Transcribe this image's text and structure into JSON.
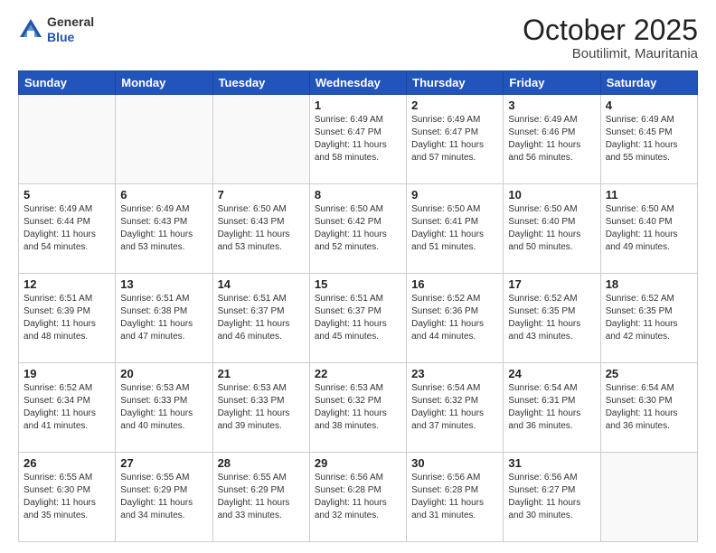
{
  "header": {
    "logo_general": "General",
    "logo_blue": "Blue",
    "month_title": "October 2025",
    "location": "Boutilimit, Mauritania"
  },
  "weekdays": [
    "Sunday",
    "Monday",
    "Tuesday",
    "Wednesday",
    "Thursday",
    "Friday",
    "Saturday"
  ],
  "weeks": [
    [
      {
        "day": "",
        "info": ""
      },
      {
        "day": "",
        "info": ""
      },
      {
        "day": "",
        "info": ""
      },
      {
        "day": "1",
        "info": "Sunrise: 6:49 AM\nSunset: 6:47 PM\nDaylight: 11 hours and 58 minutes."
      },
      {
        "day": "2",
        "info": "Sunrise: 6:49 AM\nSunset: 6:47 PM\nDaylight: 11 hours and 57 minutes."
      },
      {
        "day": "3",
        "info": "Sunrise: 6:49 AM\nSunset: 6:46 PM\nDaylight: 11 hours and 56 minutes."
      },
      {
        "day": "4",
        "info": "Sunrise: 6:49 AM\nSunset: 6:45 PM\nDaylight: 11 hours and 55 minutes."
      }
    ],
    [
      {
        "day": "5",
        "info": "Sunrise: 6:49 AM\nSunset: 6:44 PM\nDaylight: 11 hours and 54 minutes."
      },
      {
        "day": "6",
        "info": "Sunrise: 6:49 AM\nSunset: 6:43 PM\nDaylight: 11 hours and 53 minutes."
      },
      {
        "day": "7",
        "info": "Sunrise: 6:50 AM\nSunset: 6:43 PM\nDaylight: 11 hours and 53 minutes."
      },
      {
        "day": "8",
        "info": "Sunrise: 6:50 AM\nSunset: 6:42 PM\nDaylight: 11 hours and 52 minutes."
      },
      {
        "day": "9",
        "info": "Sunrise: 6:50 AM\nSunset: 6:41 PM\nDaylight: 11 hours and 51 minutes."
      },
      {
        "day": "10",
        "info": "Sunrise: 6:50 AM\nSunset: 6:40 PM\nDaylight: 11 hours and 50 minutes."
      },
      {
        "day": "11",
        "info": "Sunrise: 6:50 AM\nSunset: 6:40 PM\nDaylight: 11 hours and 49 minutes."
      }
    ],
    [
      {
        "day": "12",
        "info": "Sunrise: 6:51 AM\nSunset: 6:39 PM\nDaylight: 11 hours and 48 minutes."
      },
      {
        "day": "13",
        "info": "Sunrise: 6:51 AM\nSunset: 6:38 PM\nDaylight: 11 hours and 47 minutes."
      },
      {
        "day": "14",
        "info": "Sunrise: 6:51 AM\nSunset: 6:37 PM\nDaylight: 11 hours and 46 minutes."
      },
      {
        "day": "15",
        "info": "Sunrise: 6:51 AM\nSunset: 6:37 PM\nDaylight: 11 hours and 45 minutes."
      },
      {
        "day": "16",
        "info": "Sunrise: 6:52 AM\nSunset: 6:36 PM\nDaylight: 11 hours and 44 minutes."
      },
      {
        "day": "17",
        "info": "Sunrise: 6:52 AM\nSunset: 6:35 PM\nDaylight: 11 hours and 43 minutes."
      },
      {
        "day": "18",
        "info": "Sunrise: 6:52 AM\nSunset: 6:35 PM\nDaylight: 11 hours and 42 minutes."
      }
    ],
    [
      {
        "day": "19",
        "info": "Sunrise: 6:52 AM\nSunset: 6:34 PM\nDaylight: 11 hours and 41 minutes."
      },
      {
        "day": "20",
        "info": "Sunrise: 6:53 AM\nSunset: 6:33 PM\nDaylight: 11 hours and 40 minutes."
      },
      {
        "day": "21",
        "info": "Sunrise: 6:53 AM\nSunset: 6:33 PM\nDaylight: 11 hours and 39 minutes."
      },
      {
        "day": "22",
        "info": "Sunrise: 6:53 AM\nSunset: 6:32 PM\nDaylight: 11 hours and 38 minutes."
      },
      {
        "day": "23",
        "info": "Sunrise: 6:54 AM\nSunset: 6:32 PM\nDaylight: 11 hours and 37 minutes."
      },
      {
        "day": "24",
        "info": "Sunrise: 6:54 AM\nSunset: 6:31 PM\nDaylight: 11 hours and 36 minutes."
      },
      {
        "day": "25",
        "info": "Sunrise: 6:54 AM\nSunset: 6:30 PM\nDaylight: 11 hours and 36 minutes."
      }
    ],
    [
      {
        "day": "26",
        "info": "Sunrise: 6:55 AM\nSunset: 6:30 PM\nDaylight: 11 hours and 35 minutes."
      },
      {
        "day": "27",
        "info": "Sunrise: 6:55 AM\nSunset: 6:29 PM\nDaylight: 11 hours and 34 minutes."
      },
      {
        "day": "28",
        "info": "Sunrise: 6:55 AM\nSunset: 6:29 PM\nDaylight: 11 hours and 33 minutes."
      },
      {
        "day": "29",
        "info": "Sunrise: 6:56 AM\nSunset: 6:28 PM\nDaylight: 11 hours and 32 minutes."
      },
      {
        "day": "30",
        "info": "Sunrise: 6:56 AM\nSunset: 6:28 PM\nDaylight: 11 hours and 31 minutes."
      },
      {
        "day": "31",
        "info": "Sunrise: 6:56 AM\nSunset: 6:27 PM\nDaylight: 11 hours and 30 minutes."
      },
      {
        "day": "",
        "info": ""
      }
    ]
  ]
}
